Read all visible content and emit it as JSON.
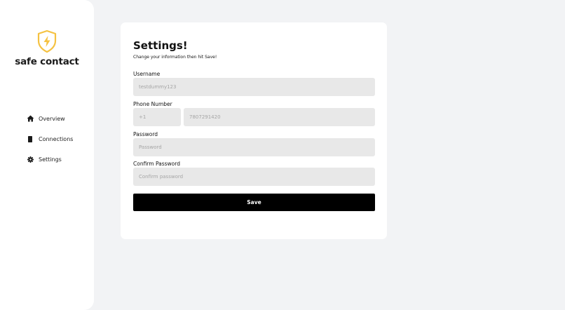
{
  "sidebar": {
    "brand": "safe contact",
    "logo_icon": "shield-bolt-icon",
    "accent_color": "#f5c242",
    "items": [
      {
        "label": "Overview",
        "icon": "home-icon"
      },
      {
        "label": "Connections",
        "icon": "bookmark-icon"
      },
      {
        "label": "Settings",
        "icon": "gear-icon"
      }
    ]
  },
  "form": {
    "title": "Settings!",
    "subtitle": "Change your information then hit Save!",
    "username": {
      "label": "Username",
      "placeholder": "testdummy123"
    },
    "phone": {
      "label": "Phone Number",
      "code_placeholder": "+1",
      "number_placeholder": "7807291420"
    },
    "password": {
      "label": "Password",
      "placeholder": "Password"
    },
    "confirm": {
      "label": "Confirm Password",
      "placeholder": "Confirm password"
    },
    "save_label": "Save"
  }
}
